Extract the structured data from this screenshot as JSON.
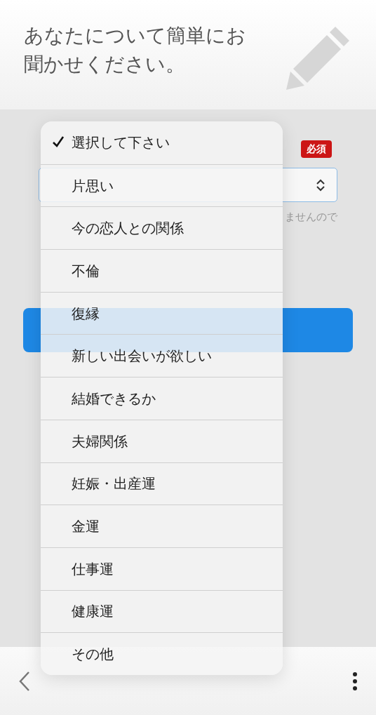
{
  "header": {
    "title": "あなたについて簡単にお聞かせください。"
  },
  "form": {
    "required_badge": "必須",
    "helper_text": "ませんので"
  },
  "dropdown": {
    "options": [
      {
        "label": "選択して下さい",
        "selected": true
      },
      {
        "label": "片思い",
        "selected": false
      },
      {
        "label": "今の恋人との関係",
        "selected": false
      },
      {
        "label": "不倫",
        "selected": false
      },
      {
        "label": "復縁",
        "selected": false
      },
      {
        "label": "新しい出会いが欲しい",
        "selected": false
      },
      {
        "label": "結婚できるか",
        "selected": false
      },
      {
        "label": "夫婦関係",
        "selected": false
      },
      {
        "label": "妊娠・出産運",
        "selected": false
      },
      {
        "label": "金運",
        "selected": false
      },
      {
        "label": "仕事運",
        "selected": false
      },
      {
        "label": "健康運",
        "selected": false
      },
      {
        "label": "その他",
        "selected": false
      }
    ]
  }
}
